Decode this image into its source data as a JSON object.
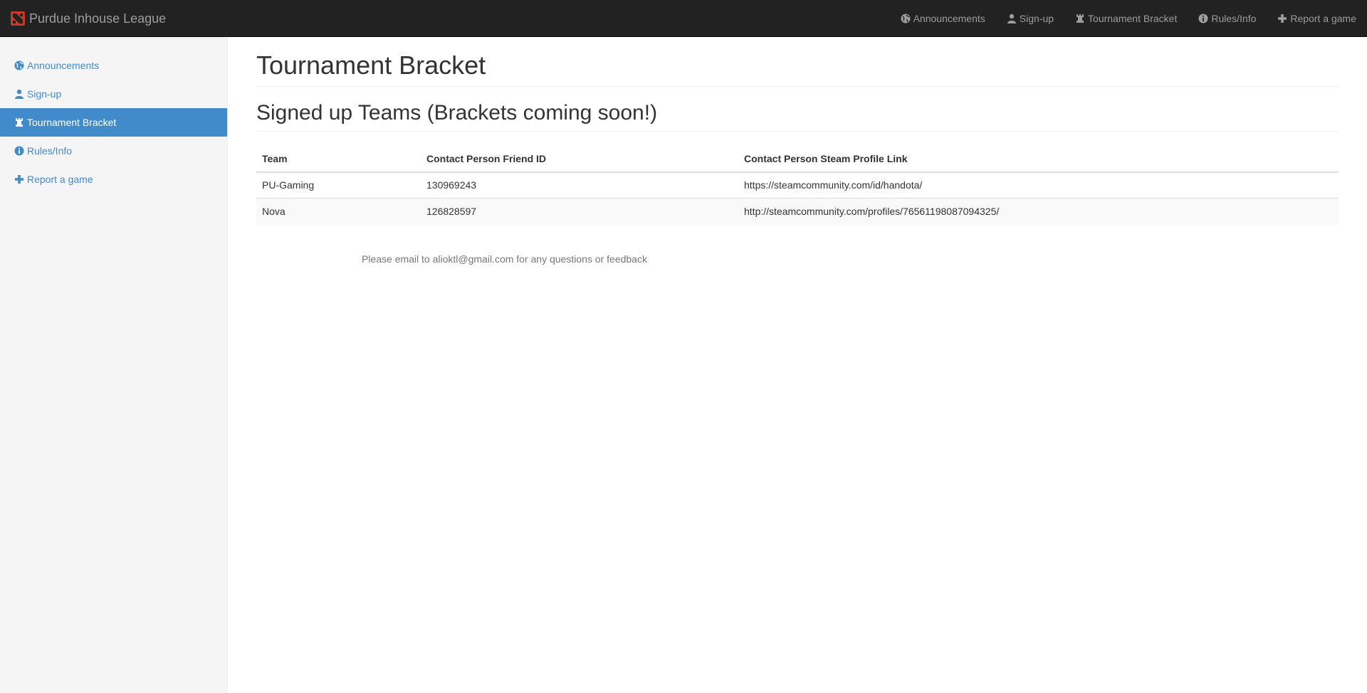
{
  "navbar": {
    "brand": "Purdue Inhouse League",
    "links": [
      {
        "label": "Announcements",
        "icon": "globe-icon"
      },
      {
        "label": "Sign-up",
        "icon": "user-icon"
      },
      {
        "label": "Tournament Bracket",
        "icon": "tower-icon"
      },
      {
        "label": "Rules/Info",
        "icon": "info-icon"
      },
      {
        "label": "Report a game",
        "icon": "plus-icon"
      }
    ]
  },
  "sidebar": {
    "items": [
      {
        "label": "Announcements",
        "icon": "globe-icon"
      },
      {
        "label": "Sign-up",
        "icon": "user-icon"
      },
      {
        "label": "Tournament Bracket",
        "icon": "tower-icon",
        "active": true
      },
      {
        "label": "Rules/Info",
        "icon": "info-icon"
      },
      {
        "label": "Report a game",
        "icon": "plus-icon"
      }
    ]
  },
  "main": {
    "title": "Tournament Bracket",
    "section_title": "Signed up Teams (Brackets coming soon!)",
    "table": {
      "headers": [
        "Team",
        "Contact Person Friend ID",
        "Contact Person Steam Profile Link"
      ],
      "rows": [
        [
          "PU-Gaming",
          "130969243",
          "https://steamcommunity.com/id/handota/"
        ],
        [
          "Nova",
          "126828597",
          "http://steamcommunity.com/profiles/76561198087094325/"
        ]
      ]
    },
    "footer": "Please email to alioktl@gmail.com for any questions or feedback"
  },
  "colors": {
    "navbar_bg": "#222222",
    "nav_text": "#9d9d9d",
    "accent": "#428bca",
    "sidebar_bg": "#f5f5f5",
    "brand_logo": "#c23c2a"
  }
}
